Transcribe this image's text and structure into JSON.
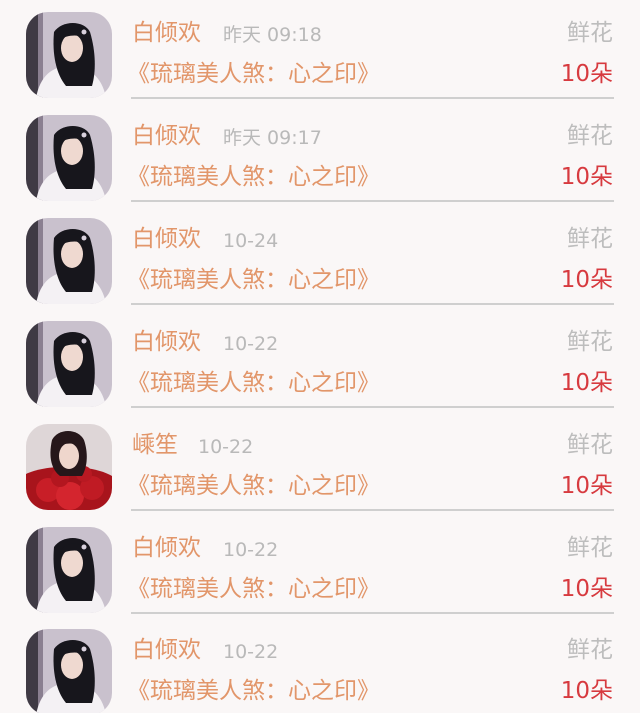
{
  "records": [
    {
      "name": "白倾欢",
      "time": "昨天 09:18",
      "gift": "鲜花",
      "book": "《琉璃美人煞：心之印》",
      "count": "10朵",
      "avatar": "portrait-white-robe"
    },
    {
      "name": "白倾欢",
      "time": "昨天 09:17",
      "gift": "鲜花",
      "book": "《琉璃美人煞：心之印》",
      "count": "10朵",
      "avatar": "portrait-white-robe"
    },
    {
      "name": "白倾欢",
      "time": "10-24",
      "gift": "鲜花",
      "book": "《琉璃美人煞：心之印》",
      "count": "10朵",
      "avatar": "portrait-white-robe"
    },
    {
      "name": "白倾欢",
      "time": "10-22",
      "gift": "鲜花",
      "book": "《琉璃美人煞：心之印》",
      "count": "10朵",
      "avatar": "portrait-white-robe"
    },
    {
      "name": "嵊笙",
      "time": "10-22",
      "gift": "鲜花",
      "book": "《琉璃美人煞：心之印》",
      "count": "10朵",
      "avatar": "portrait-red-roses"
    },
    {
      "name": "白倾欢",
      "time": "10-22",
      "gift": "鲜花",
      "book": "《琉璃美人煞：心之印》",
      "count": "10朵",
      "avatar": "portrait-white-robe"
    },
    {
      "name": "白倾欢",
      "time": "10-22",
      "gift": "鲜花",
      "book": "《琉璃美人煞：心之印》",
      "count": "10朵",
      "avatar": "portrait-white-robe"
    }
  ],
  "colors": {
    "background": "#faf7f7",
    "name": "#e2966a",
    "book": "#e2966a",
    "count": "#d73a3f",
    "muted": "#b9b9b9",
    "divider": "#cfcfcf"
  }
}
